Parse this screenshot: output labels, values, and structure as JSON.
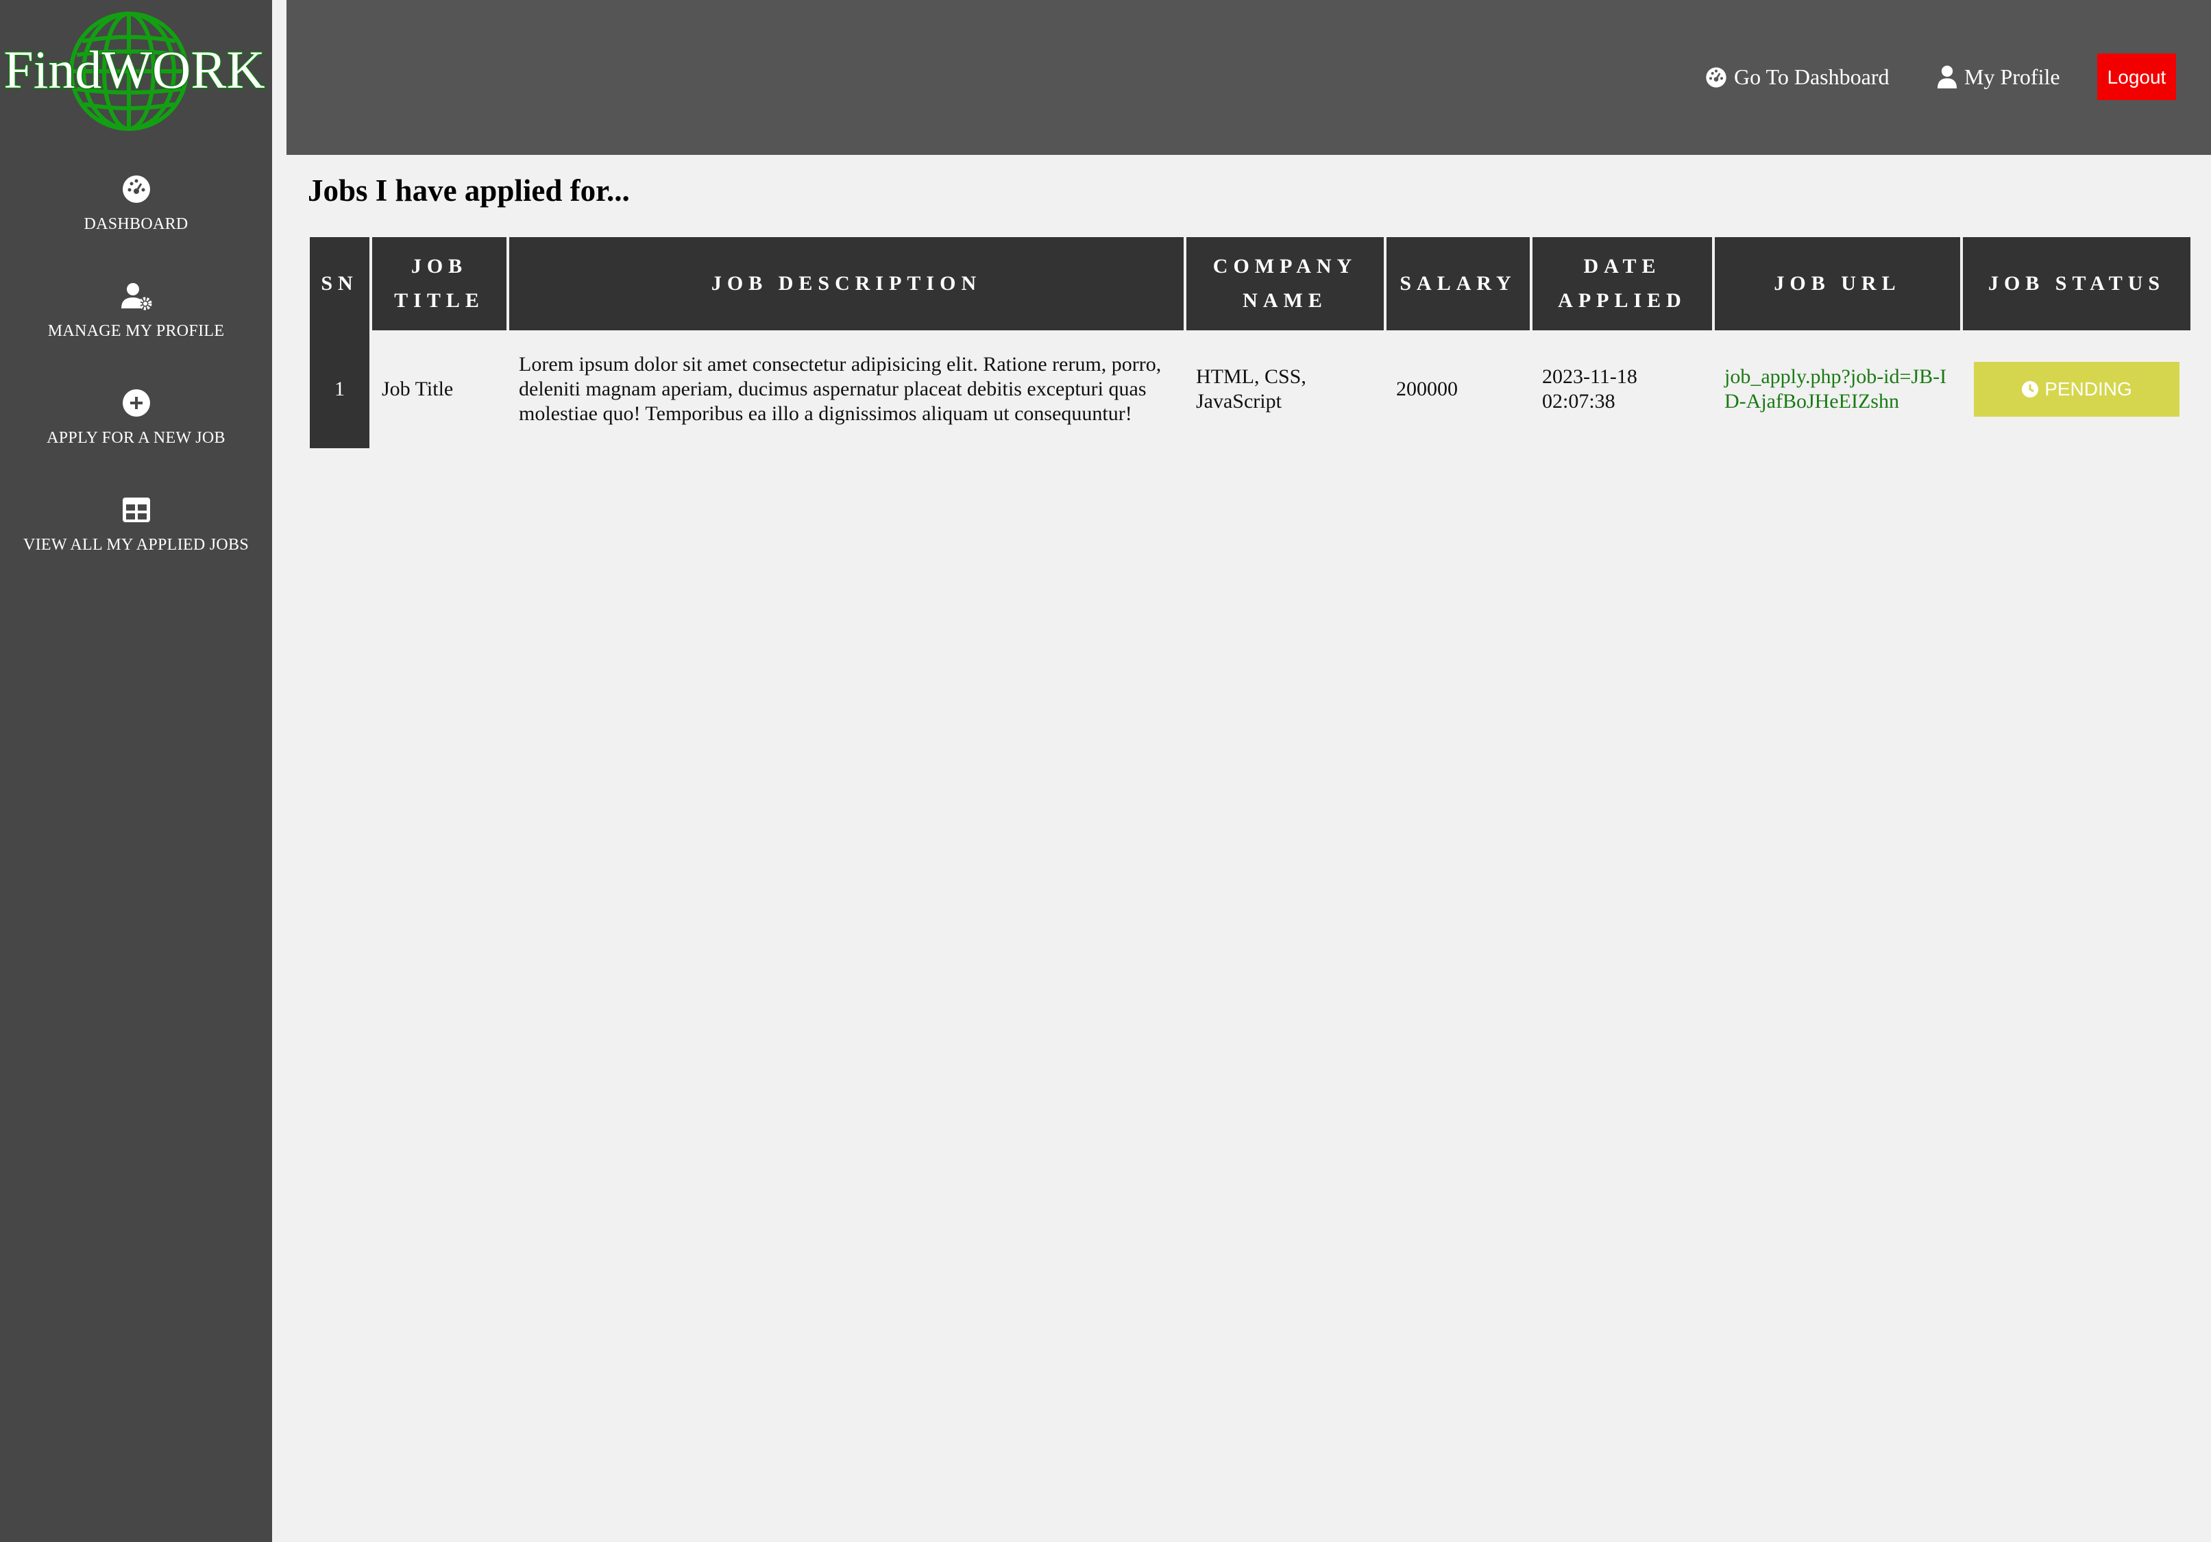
{
  "brand": {
    "name": "FindWORK",
    "colors": {
      "globe": "#12a012",
      "text": "#ffffff",
      "outline": "#0b7d0b"
    }
  },
  "sidebar": {
    "items": [
      {
        "label": "DASHBOARD",
        "icon": "gauge-icon"
      },
      {
        "label": "MANAGE MY PROFILE",
        "icon": "user-cog-icon"
      },
      {
        "label": "APPLY FOR A NEW JOB",
        "icon": "plus-circle-icon"
      },
      {
        "label": "VIEW ALL MY APPLIED JOBS",
        "icon": "table-icon"
      }
    ]
  },
  "topbar": {
    "dashboard_link": "Go To Dashboard",
    "dashboard_icon": "gauge-icon",
    "profile_link": "My Profile",
    "profile_icon": "user-icon",
    "logout_label": "Logout",
    "logout_color": "#f20000"
  },
  "main": {
    "title": "Jobs I have applied for...",
    "table": {
      "columns": [
        "SN",
        "JOB TITLE",
        "JOB DESCRIPTION",
        "COMPANY NAME",
        "SALARY",
        "DATE APPLIED",
        "JOB URL",
        "JOB STATUS"
      ],
      "rows": [
        {
          "sn": "1",
          "job_title": "Job Title",
          "description": "Lorem ipsum dolor sit amet consectetur adipisicing elit. Ratione rerum, porro, deleniti magnam aperiam, ducimus aspernatur placeat debitis excepturi quas molestiae quo! Temporibus ea illo a dignissimos aliquam ut consequuntur!",
          "company": "HTML, CSS, JavaScript",
          "salary": "200000",
          "date_applied": "2023-11-18 02:07:38",
          "url": "job_apply.php?job-id=JB-ID-AjafBoJHeEIZshn",
          "status": "PENDING",
          "status_icon": "clock-icon",
          "status_color": "#d6d64e"
        }
      ]
    }
  }
}
